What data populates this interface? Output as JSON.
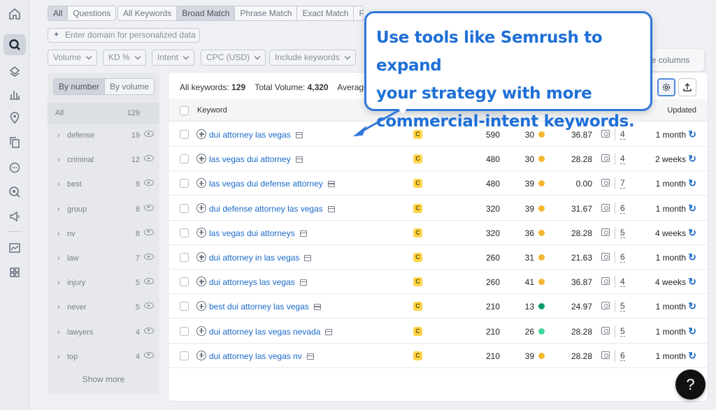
{
  "rail": {
    "items": [
      "home-icon",
      "keyword-magic-icon",
      "layers-icon",
      "chart-icon",
      "location-icon",
      "copy-icon",
      "chat-icon",
      "target-icon",
      "megaphone-icon",
      "trend-icon",
      "grid-icon"
    ]
  },
  "filters": {
    "question_tabs": [
      "All",
      "Questions"
    ],
    "match_tabs": [
      "All Keywords",
      "Broad Match",
      "Phrase Match",
      "Exact Match",
      "Relat"
    ],
    "selected_match": "Broad Match",
    "domain_placeholder": "Enter domain for personalized data",
    "dropdowns": [
      "Volume",
      "KD %",
      "Intent",
      "CPC (USD)",
      "Include keywords"
    ],
    "manage_columns": "ge columns"
  },
  "groups": {
    "toggle": [
      "By number",
      "By volume"
    ],
    "header_label": "All",
    "header_count": "129",
    "items": [
      {
        "label": "defense",
        "count": "19"
      },
      {
        "label": "criminal",
        "count": "12"
      },
      {
        "label": "best",
        "count": "9"
      },
      {
        "label": "group",
        "count": "8"
      },
      {
        "label": "nv",
        "count": "8"
      },
      {
        "label": "law",
        "count": "7"
      },
      {
        "label": "injury",
        "count": "5"
      },
      {
        "label": "never",
        "count": "5"
      },
      {
        "label": "lawyers",
        "count": "4"
      },
      {
        "label": "top",
        "count": "4"
      }
    ],
    "show_more": "Show more"
  },
  "table": {
    "summary_label1": "All keywords:",
    "summary_value1": "129",
    "summary_label2": "Total Volume:",
    "summary_value2": "4,320",
    "summary_label3": "Average",
    "col_keyword": "Keyword",
    "col_updated": "Updated",
    "rows": [
      {
        "keyword": "dui attorney las vegas",
        "intent": "C",
        "volume": "590",
        "kd": "30",
        "kd_color": "#f5b731",
        "cpc": "36.87",
        "results": "4",
        "updated": "1 month"
      },
      {
        "keyword": "las vegas dui attorney",
        "intent": "C",
        "volume": "480",
        "kd": "30",
        "kd_color": "#f5b731",
        "cpc": "28.28",
        "results": "4",
        "updated": "2 weeks"
      },
      {
        "keyword": "las vegas dui defense attorney",
        "intent": "C",
        "volume": "480",
        "kd": "39",
        "kd_color": "#f5b731",
        "cpc": "0.00",
        "results": "7",
        "updated": "1 month"
      },
      {
        "keyword": "dui defense attorney las vegas",
        "intent": "C",
        "volume": "320",
        "kd": "39",
        "kd_color": "#f5b731",
        "cpc": "31.67",
        "results": "6",
        "updated": "1 month"
      },
      {
        "keyword": "las vegas dui attorneys",
        "intent": "C",
        "volume": "320",
        "kd": "36",
        "kd_color": "#f5b731",
        "cpc": "28.28",
        "results": "5",
        "updated": "4 weeks"
      },
      {
        "keyword": "dui attorney in las vegas",
        "intent": "C",
        "volume": "260",
        "kd": "31",
        "kd_color": "#f5b731",
        "cpc": "21.63",
        "results": "6",
        "updated": "1 month"
      },
      {
        "keyword": "dui attorneys las vegas",
        "intent": "C",
        "volume": "260",
        "kd": "41",
        "kd_color": "#f5b731",
        "cpc": "36.87",
        "results": "4",
        "updated": "4 weeks"
      },
      {
        "keyword": "best dui attorney las vegas",
        "intent": "C",
        "volume": "210",
        "kd": "13",
        "kd_color": "#0f9a6e",
        "cpc": "24.97",
        "results": "5",
        "updated": "1 month"
      },
      {
        "keyword": "dui attorney las vegas nevada",
        "intent": "C",
        "volume": "210",
        "kd": "26",
        "kd_color": "#3fd49a",
        "cpc": "28.28",
        "results": "5",
        "updated": "1 month"
      },
      {
        "keyword": "dui attorney las vegas nv",
        "intent": "C",
        "volume": "210",
        "kd": "39",
        "kd_color": "#f5b731",
        "cpc": "28.28",
        "results": "6",
        "updated": "1 month"
      }
    ]
  },
  "callout": {
    "lines": [
      "Use tools like Semrush to expand",
      "your strategy with more",
      "commercial-intent keywords."
    ],
    "color": "#1f6fd6"
  },
  "help": "?"
}
